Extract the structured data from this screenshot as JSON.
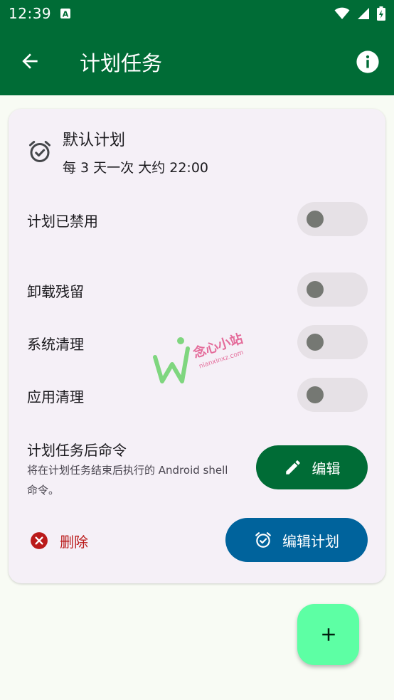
{
  "status_bar": {
    "time": "12:39"
  },
  "app_bar": {
    "title": "计划任务"
  },
  "plan": {
    "name": "默认计划",
    "frequency": "每 3 天一次 大约 22:00"
  },
  "toggles": [
    {
      "label": "计划已禁用",
      "on": false
    },
    {
      "label": "卸载残留",
      "on": false
    },
    {
      "label": "系统清理",
      "on": false
    },
    {
      "label": "应用清理",
      "on": false
    }
  ],
  "post_command": {
    "title": "计划任务后命令",
    "description": "将在计划任务结束后执行的 Android shell 命令。",
    "edit_label": "编辑"
  },
  "actions": {
    "delete_label": "删除",
    "edit_plan_label": "编辑计划"
  },
  "watermark": {
    "cn": "念心小站",
    "en": "nianxinxz.com"
  },
  "colors": {
    "primary": "#006C36",
    "secondary": "#00639C",
    "error": "#BA1A1A",
    "fab": "#5DFFA4",
    "card": "#F5F0F7"
  }
}
